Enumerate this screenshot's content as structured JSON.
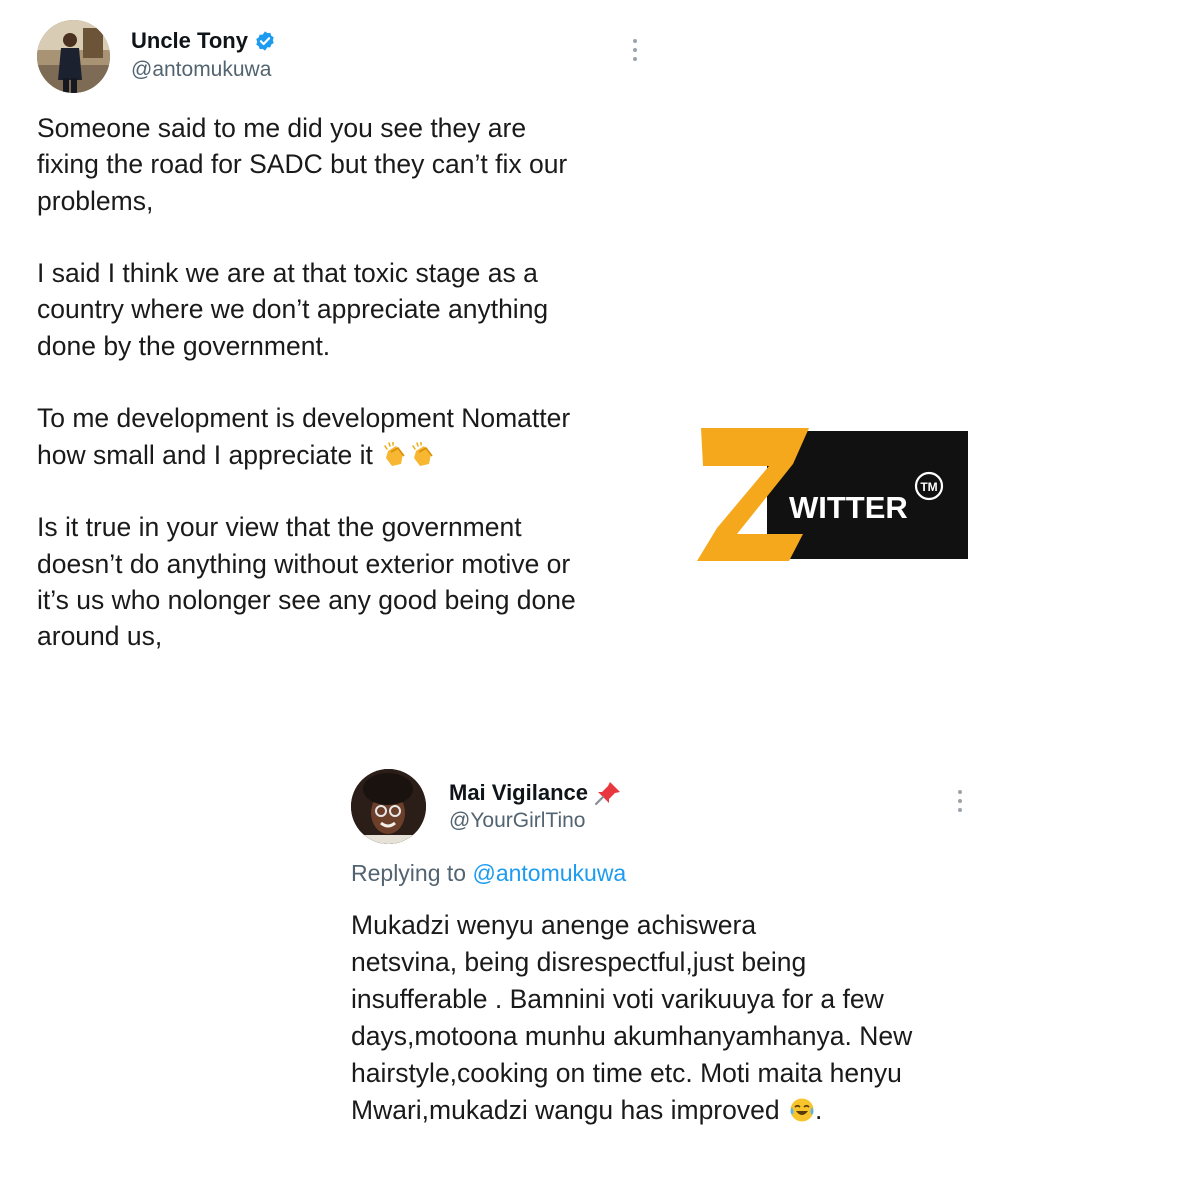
{
  "tweet1": {
    "display_name": "Uncle Tony",
    "handle": "@antomukuwa",
    "verified": true,
    "paragraphs": [
      [
        "Someone said to me did you see they are",
        "fixing the road for SADC but they can’t fix our",
        "problems,"
      ],
      [
        "I said I think we are at that toxic stage as a",
        "country where we don’t appreciate anything",
        "done by the government."
      ],
      [
        "To me development is development Nomatter",
        "how small and I appreciate it"
      ],
      [
        "Is it true in your view that the government",
        "doesn’t do anything without exterior motive or",
        "it’s us who nolonger see any good being done",
        "around us,"
      ]
    ],
    "emoji": [
      "clapping-hands-emoji",
      "clapping-hands-emoji"
    ]
  },
  "tweet2": {
    "display_name": "Mai Vigilance",
    "name_emoji": "pushpin-emoji",
    "handle": "@YourGirlTino",
    "replying_to_label": "Replying to",
    "replying_to_mention": "@antomukuwa",
    "lines": [
      "Mukadzi wenyu anenge achiswera",
      "netsvina, being disrespectful,just being",
      "insufferable . Bamnini voti varikuuya for a few",
      "days,motoona munhu akumhanyamhanya. New",
      "hairstyle,cooking on time etc. Moti maita henyu",
      "Mwari,mukadzi wangu has improved"
    ],
    "trailing_emoji": "tears-of-joy-emoji",
    "trailing_text": "."
  },
  "logo": {
    "text": "WITTER",
    "trademark": "TM",
    "colors": {
      "z": "#f5a81c",
      "background": "#111111",
      "text": "#ffffff"
    }
  },
  "colors": {
    "verified": "#1d9bf0",
    "mention": "#1d9bf0",
    "secondary_text": "#536471"
  }
}
